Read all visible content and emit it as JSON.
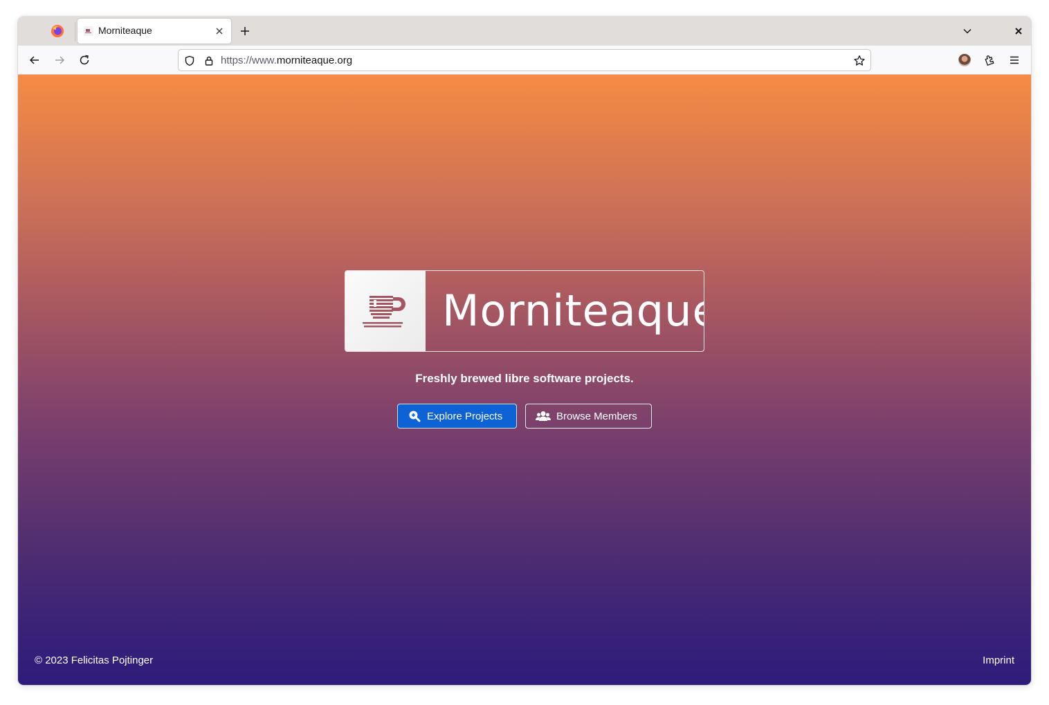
{
  "browser": {
    "tab": {
      "title": "Morniteaque"
    },
    "url": {
      "prefix": "https://www.",
      "host": "morniteaque.org"
    },
    "icons": [
      "firefox-icon",
      "tab-favicon",
      "close-icon",
      "plus-icon",
      "chevron-down-icon",
      "window-close-icon",
      "back-arrow-icon",
      "forward-arrow-icon",
      "reload-icon",
      "shield-icon",
      "lock-icon",
      "star-icon",
      "avatar",
      "extensions-icon",
      "menu-icon"
    ]
  },
  "page": {
    "logo_text": "Morniteaque",
    "tagline": "Freshly brewed libre software projects.",
    "buttons": {
      "explore": "Explore Projects",
      "members": "Browse Members"
    },
    "footer": {
      "copyright": "© 2023 Felicitas Pojtinger",
      "imprint": "Imprint"
    },
    "colors": {
      "gradient_top": "#f58b44",
      "gradient_bottom": "#2e1c7b",
      "primary_button": "#0d63d6",
      "logo_accent": "#a35562"
    }
  }
}
